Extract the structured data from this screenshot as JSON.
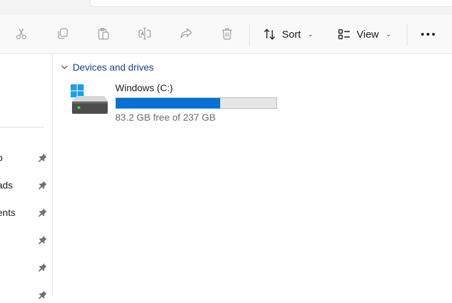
{
  "toolbar": {
    "icons": [
      "cut-icon",
      "copy-icon",
      "paste-icon",
      "rename-icon",
      "share-icon",
      "delete-icon"
    ],
    "sort_label": "Sort",
    "view_label": "View",
    "more_label": "..."
  },
  "nav": {
    "items": [
      {
        "label": "p",
        "pinned": true
      },
      {
        "label": "ads",
        "pinned": true
      },
      {
        "label": "ents",
        "pinned": true
      },
      {
        "label": "",
        "pinned": true
      },
      {
        "label": "",
        "pinned": true
      },
      {
        "label": "",
        "pinned": true
      }
    ]
  },
  "content": {
    "section_title": "Devices and drives",
    "drives": [
      {
        "name": "Windows (C:)",
        "free_text": "83.2 GB free of 237 GB",
        "used_fraction": 0.649
      }
    ]
  },
  "colors": {
    "accent": "#0a6fd0",
    "section_header": "#1a3f80",
    "secondary_text": "#6b6b6b"
  }
}
